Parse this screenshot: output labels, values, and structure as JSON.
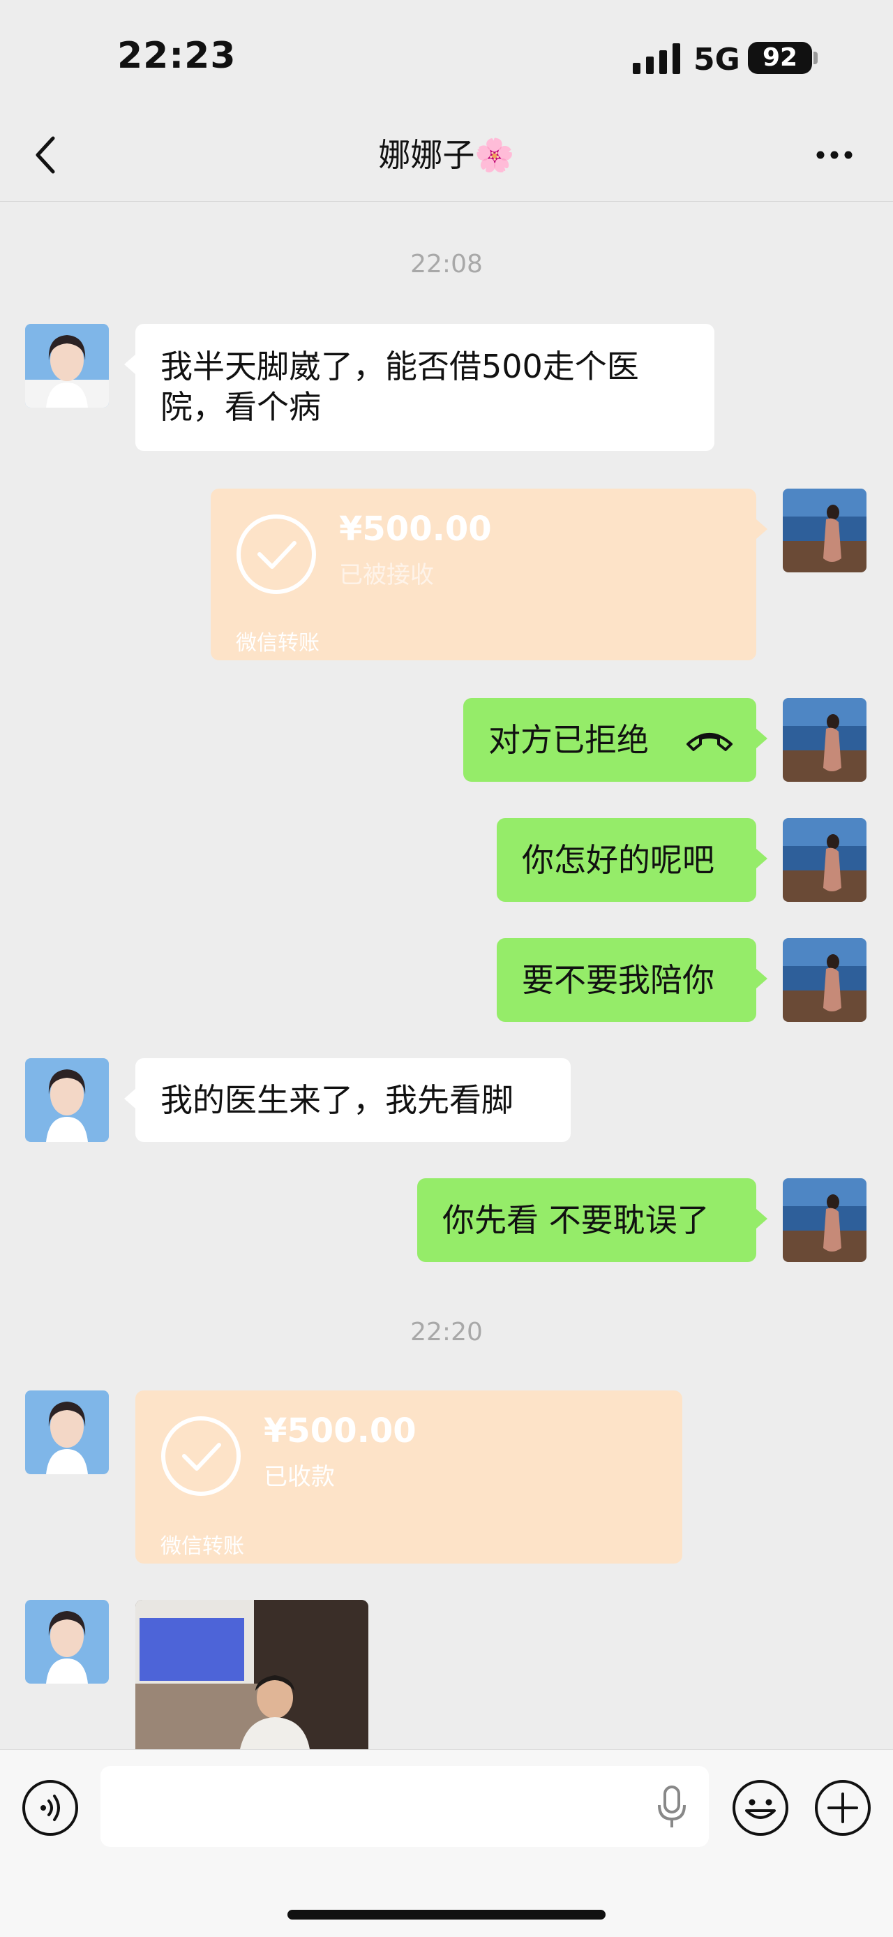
{
  "status_bar": {
    "time": "22:23",
    "network": "5G",
    "battery": "92"
  },
  "header": {
    "title": "娜娜子🌸"
  },
  "messages": [
    {
      "type": "time",
      "text": "22:08"
    },
    {
      "type": "text",
      "from": "contact",
      "text_line1": "我半天脚崴了，能否借500走个医",
      "text_line2": "院，看个病"
    },
    {
      "type": "transfer",
      "from": "me",
      "amount": "¥500.00",
      "status": "已被接收",
      "footer": "微信转账"
    },
    {
      "type": "call",
      "from": "me",
      "text": "对方已拒绝"
    },
    {
      "type": "text",
      "from": "me",
      "text": "你怎好的呢吧"
    },
    {
      "type": "text",
      "from": "me",
      "text": "要不要我陪你"
    },
    {
      "type": "text",
      "from": "contact",
      "text": "我的医生来了，我先看脚"
    },
    {
      "type": "text",
      "from": "me",
      "text": "你先看 不要耽误了"
    },
    {
      "type": "time",
      "text": "22:20"
    },
    {
      "type": "transfer",
      "from": "contact",
      "amount": "¥500.00",
      "status": "已收款",
      "footer": "微信转账"
    },
    {
      "type": "image",
      "from": "contact"
    }
  ],
  "colors": {
    "bubble_me": "#95ec69",
    "bubble_contact": "#ffffff",
    "transfer": "#fde3c8",
    "background": "#ededed"
  },
  "icons": [
    "back-icon",
    "more-icon",
    "voice-toggle-icon",
    "mic-icon",
    "emoji-icon",
    "add-icon",
    "call-hangup-icon",
    "check-circle-icon"
  ]
}
